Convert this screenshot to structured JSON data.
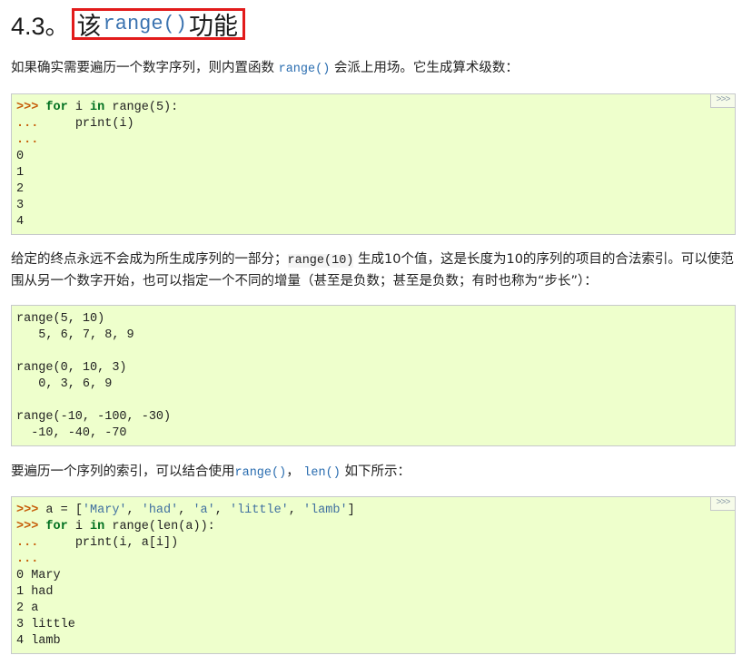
{
  "heading": {
    "number": "4.3。",
    "prefix": "该",
    "code": "range()",
    "suffix": "功能"
  },
  "para1": {
    "before": "如果确实需要遍历一个数字序列，则内置函数 ",
    "code": "range()",
    "after": " 会派上用场。它生成算术级数："
  },
  "para2": {
    "before": "给定的终点永远不会成为所生成序列的一部分；",
    "code": "range(10)",
    "after1": " 生成10个值，这是长度为10的序列的项目的合法索引。可以使范围从另一个数字开始，也可以指定一个不同的增量（甚至是负数；甚至是负数；有时也称为“步长”）："
  },
  "para3": {
    "before": "要遍历一个序列的索引，可以结合使用",
    "code1": "range()",
    "sep": "， ",
    "code2": "len()",
    "after": " 如下所示："
  },
  "copy_button": ">>>",
  "code1": {
    "l1_prompt": ">>>",
    "l1_kw1": "for",
    "l1_mid1": " i ",
    "l1_kw2": "in",
    "l1_rest": " range(5):",
    "l2_prompt": "...",
    "l2_rest": "     print(i)",
    "l3_prompt": "...",
    "out": [
      "0",
      "1",
      "2",
      "3",
      "4"
    ]
  },
  "code2": {
    "lines": [
      "range(5, 10)",
      "   5, 6, 7, 8, 9",
      "",
      "range(0, 10, 3)",
      "   0, 3, 6, 9",
      "",
      "range(-10, -100, -30)",
      "  -10, -40, -70"
    ]
  },
  "code3": {
    "l1_prompt": ">>>",
    "l1_pre": " a = [",
    "s1": "'Mary'",
    "c1": ", ",
    "s2": "'had'",
    "c2": ", ",
    "s3": "'a'",
    "c3": ", ",
    "s4": "'little'",
    "c4": ", ",
    "s5": "'lamb'",
    "l1_end": "]",
    "l2_prompt": ">>>",
    "l2_kw1": "for",
    "l2_mid": " i ",
    "l2_kw2": "in",
    "l2_rest": " range(len(a)):",
    "l3_prompt": "...",
    "l3_rest": "     print(i, a[i])",
    "l4_prompt": "...",
    "out": [
      "0 Mary",
      "1 had",
      "2 a",
      "3 little",
      "4 lamb"
    ]
  }
}
